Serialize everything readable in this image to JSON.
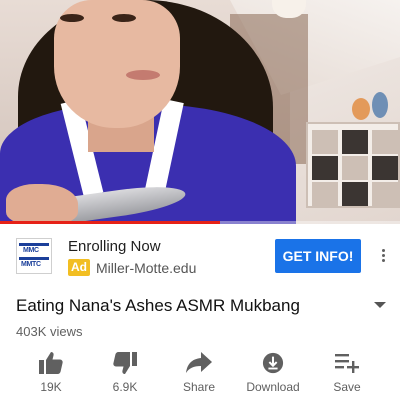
{
  "video": {
    "progress_percent": 55
  },
  "ad": {
    "logo_lines": [
      "MMC",
      "MMTC"
    ],
    "title": "Enrolling Now",
    "badge": "Ad",
    "url": "Miller-Motte.edu",
    "cta_label": "GET INFO!"
  },
  "video_info": {
    "title": "Eating Nana's Ashes ASMR Mukbang",
    "views": "403K views"
  },
  "actions": [
    {
      "label": "19K",
      "icon": "thumbs-up-icon"
    },
    {
      "label": "6.9K",
      "icon": "thumbs-down-icon"
    },
    {
      "label": "Share",
      "icon": "share-arrow-icon"
    },
    {
      "label": "Download",
      "icon": "download-icon"
    },
    {
      "label": "Save",
      "icon": "playlist-add-icon"
    }
  ],
  "colors": {
    "progress": "#e62117",
    "cta": "#1a73e8",
    "ad_badge": "#f2be22"
  }
}
